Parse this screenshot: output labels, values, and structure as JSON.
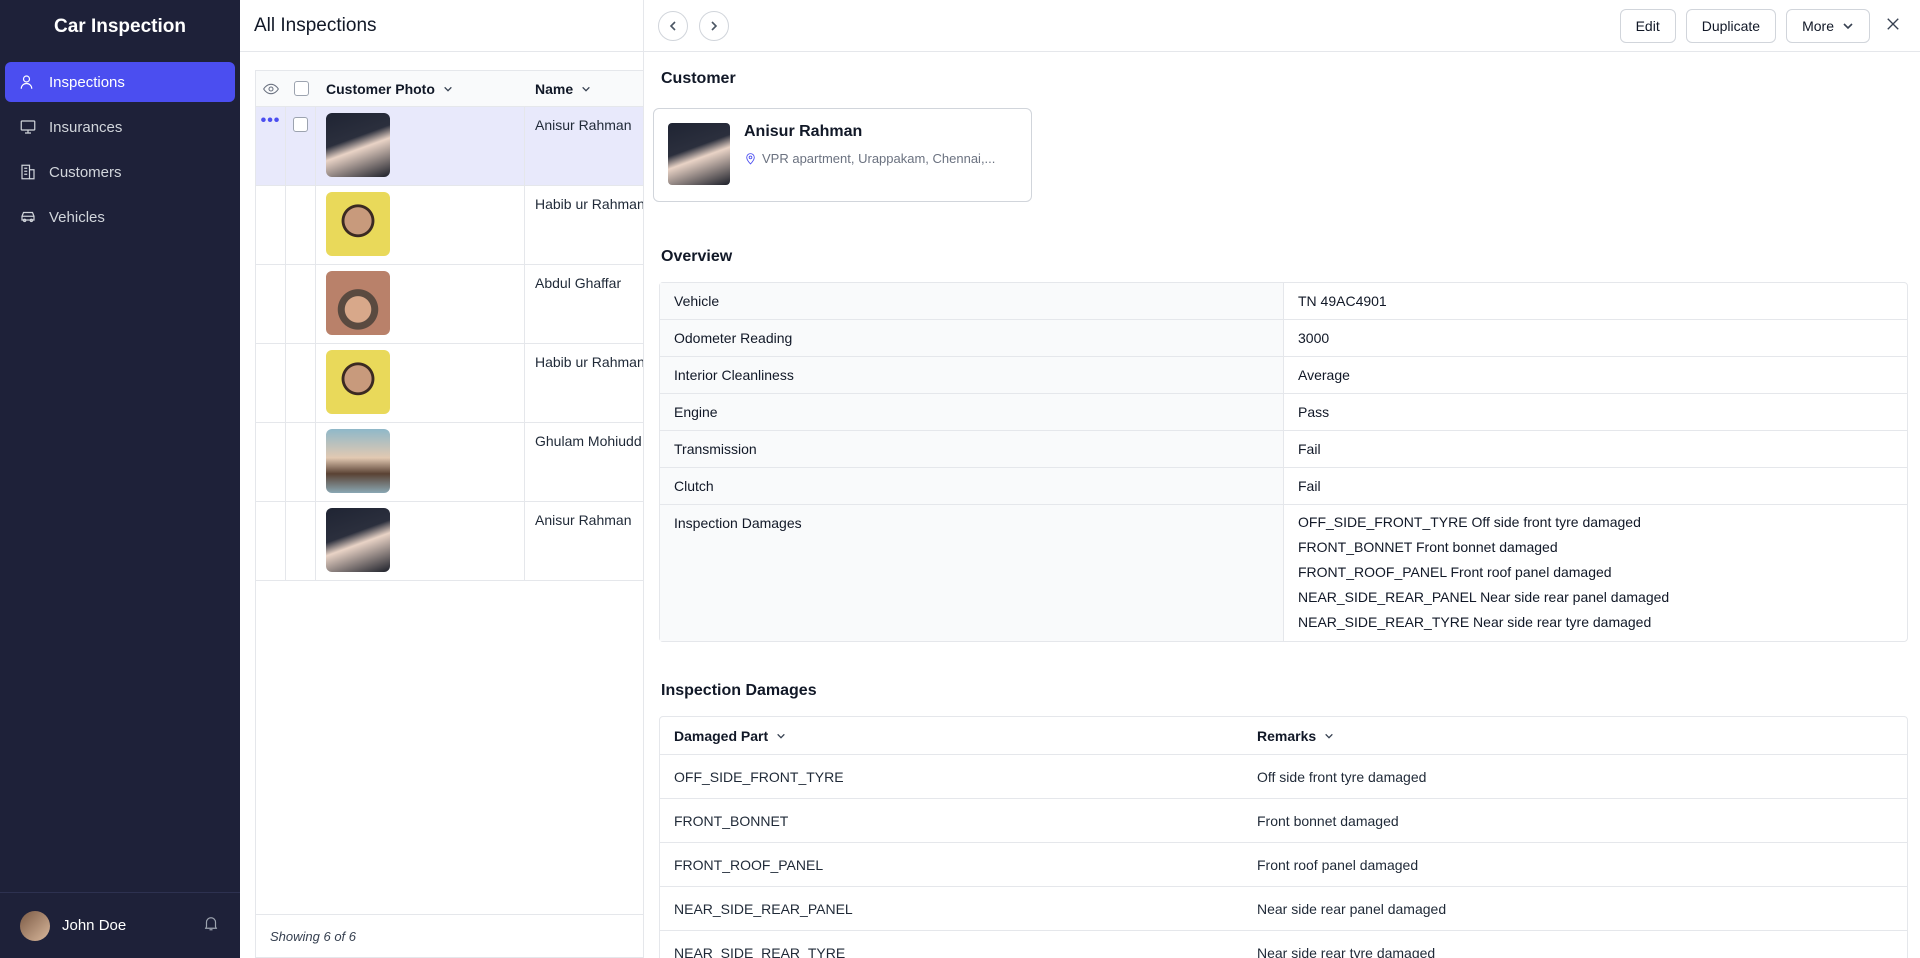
{
  "sidebar": {
    "app_title": "Car Inspection",
    "items": [
      {
        "label": "Inspections",
        "icon": "user-check-icon",
        "active": true
      },
      {
        "label": "Insurances",
        "icon": "monitor-icon"
      },
      {
        "label": "Customers",
        "icon": "building-icon"
      },
      {
        "label": "Vehicles",
        "icon": "car-icon"
      }
    ],
    "user": {
      "name": "John Doe"
    }
  },
  "main": {
    "title": "All Inspections",
    "columns": {
      "photo": "Customer Photo",
      "name": "Name"
    },
    "rows": [
      {
        "name": "Anisur Rahman"
      },
      {
        "name": "Habib ur Rahman"
      },
      {
        "name": "Abdul Ghaffar"
      },
      {
        "name": "Habib ur Rahman"
      },
      {
        "name": "Ghulam Mohiudd"
      },
      {
        "name": "Anisur Rahman"
      }
    ],
    "row_actions_icon": "•••",
    "footer": "Showing 6 of 6"
  },
  "detail": {
    "toolbar": {
      "edit": "Edit",
      "duplicate": "Duplicate",
      "more": "More"
    },
    "customer_section": "Customer",
    "customer": {
      "name": "Anisur Rahman",
      "address": "VPR apartment, Urappakam, Chennai,..."
    },
    "overview_section": "Overview",
    "overview": [
      {
        "label": "Vehicle",
        "value": "TN 49AC4901"
      },
      {
        "label": "Odometer Reading",
        "value": "3000"
      },
      {
        "label": "Interior Cleanliness",
        "value": "Average"
      },
      {
        "label": "Engine",
        "value": "Pass"
      },
      {
        "label": "Transmission",
        "value": "Fail"
      },
      {
        "label": "Clutch",
        "value": "Fail"
      }
    ],
    "overview_damages": {
      "label": "Inspection Damages",
      "lines": [
        "OFF_SIDE_FRONT_TYRE Off side front tyre damaged",
        "FRONT_BONNET Front bonnet damaged",
        "FRONT_ROOF_PANEL Front roof panel damaged",
        "NEAR_SIDE_REAR_PANEL Near side rear panel damaged",
        "NEAR_SIDE_REAR_TYRE Near side rear tyre damaged"
      ]
    },
    "damages_section": "Inspection Damages",
    "damages_columns": {
      "part": "Damaged Part",
      "remarks": "Remarks"
    },
    "damages": [
      {
        "part": "OFF_SIDE_FRONT_TYRE",
        "remarks": "Off side front tyre damaged"
      },
      {
        "part": "FRONT_BONNET",
        "remarks": "Front bonnet damaged"
      },
      {
        "part": "FRONT_ROOF_PANEL",
        "remarks": "Front roof panel damaged"
      },
      {
        "part": "NEAR_SIDE_REAR_PANEL",
        "remarks": "Near side rear panel damaged"
      },
      {
        "part": "NEAR_SIDE_REAR_TYRE",
        "remarks": "Near side rear tyre damaged"
      }
    ]
  },
  "colors": {
    "sidebar_bg": "#1e2139",
    "accent": "#4b4ef0",
    "selected_row": "#e8e9fb"
  }
}
